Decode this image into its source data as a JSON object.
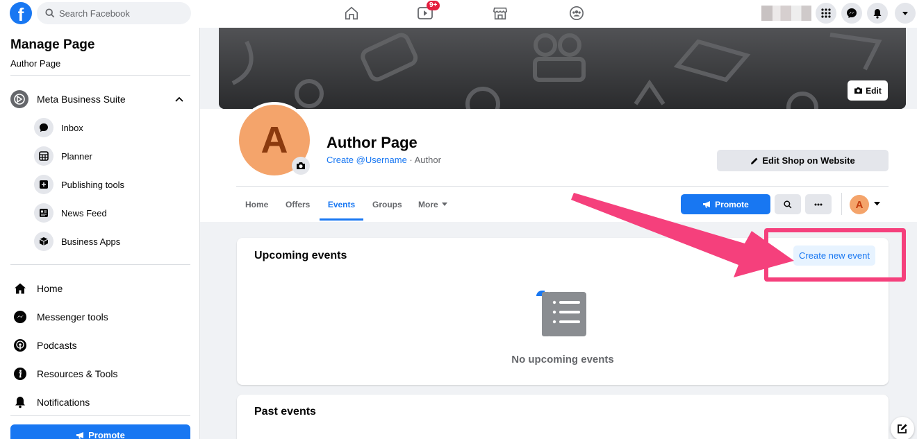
{
  "topbar": {
    "search_placeholder": "Search Facebook",
    "video_badge": "9+"
  },
  "sidebar": {
    "title": "Manage Page",
    "subtitle": "Author Page",
    "suite_label": "Meta Business Suite",
    "suite_items": [
      {
        "label": "Inbox",
        "icon": "chat-bubble-icon"
      },
      {
        "label": "Planner",
        "icon": "calendar-grid-icon"
      },
      {
        "label": "Publishing tools",
        "icon": "publishing-icon"
      },
      {
        "label": "News Feed",
        "icon": "news-feed-icon"
      },
      {
        "label": "Business Apps",
        "icon": "cube-icon"
      }
    ],
    "items": [
      {
        "label": "Home",
        "icon": "home-icon"
      },
      {
        "label": "Messenger tools",
        "icon": "messenger-icon"
      },
      {
        "label": "Podcasts",
        "icon": "podcast-icon"
      },
      {
        "label": "Resources & Tools",
        "icon": "info-icon"
      },
      {
        "label": "Notifications",
        "icon": "bell-icon"
      }
    ],
    "promote_label": "Promote"
  },
  "page": {
    "avatar_letter": "A",
    "cover_edit_label": "Edit",
    "name": "Author Page",
    "username_link": "Create @Username",
    "category": " · Author",
    "edit_shop_label": "Edit Shop on Website",
    "tabs": [
      "Home",
      "Offers",
      "Events",
      "Groups",
      "More"
    ],
    "active_tab": "Events",
    "promote_label": "Promote",
    "small_avatar_letter": "A"
  },
  "events": {
    "upcoming_title": "Upcoming events",
    "create_label": "Create new event",
    "empty_label": "No upcoming events",
    "past_title": "Past events"
  },
  "colors": {
    "brand_blue": "#1877f2",
    "annotation_pink": "#f5407c",
    "avatar_orange": "#f4a46b"
  }
}
